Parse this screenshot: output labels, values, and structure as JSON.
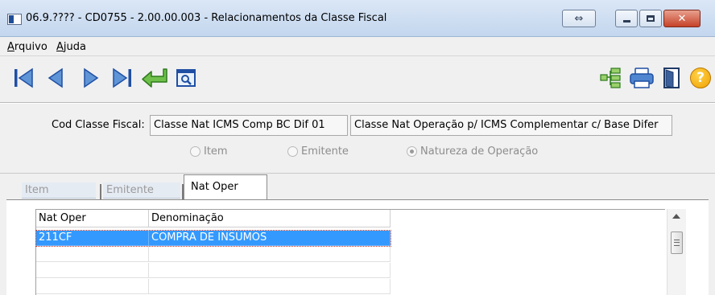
{
  "window": {
    "title": "06.9.???? - CD0755 - 2.00.00.003 - Relacionamentos da Classe Fiscal",
    "swap_glyph": "⇔",
    "close_glyph": "✕"
  },
  "menu": {
    "items": [
      {
        "first": "A",
        "rest": "rquivo"
      },
      {
        "first": "A",
        "rest": "juda"
      }
    ]
  },
  "toolbar": {
    "icons": [
      "first-record-icon",
      "previous-record-icon",
      "next-record-icon",
      "last-record-icon",
      "go-to-icon",
      "search-icon",
      "tree-icon",
      "print-icon",
      "exit-door-icon",
      "help-icon"
    ],
    "help_glyph": "?"
  },
  "form": {
    "cod_label": "Cod Classe Fiscal:",
    "class_field_1": "Classe Nat ICMS Comp BC Dif 01",
    "class_field_2": "Classe Nat Operação p/ ICMS Complementar c/ Base Difer",
    "radios": [
      {
        "label": "Item",
        "selected": false
      },
      {
        "label": "Emitente",
        "selected": false
      },
      {
        "label": "Natureza de Operação",
        "selected": true
      }
    ]
  },
  "tabs": [
    {
      "label": "Item",
      "active": false
    },
    {
      "label": "Emitente",
      "active": false
    },
    {
      "label": "Nat Oper",
      "active": true
    }
  ],
  "grid": {
    "columns": [
      "Nat Oper",
      "Denominação"
    ],
    "rows": [
      [
        "211CF",
        "COMPRA DE INSUMOS"
      ],
      [
        "",
        ""
      ],
      [
        "",
        ""
      ],
      [
        "",
        ""
      ]
    ],
    "selected_row": 0
  },
  "colors": {
    "selection": "#3399ff",
    "nav_blue": "#1f4fa3",
    "accent_green": "#4aa82c",
    "help_orange": "#f0a100"
  }
}
